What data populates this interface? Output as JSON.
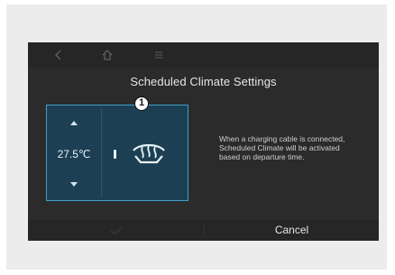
{
  "window": {
    "title": "Scheduled Climate Settings"
  },
  "nav": {
    "icons": [
      "back-arrow-icon",
      "home-icon",
      "menu-icon"
    ]
  },
  "climate": {
    "temperature": "27.5℃",
    "badge_number": "1",
    "mode_icon": "rear-defrost-icon",
    "accent": "#3fa0c9"
  },
  "info": {
    "text": "When a charging cable is connected, Scheduled Climate will be activated based on departure time."
  },
  "actions": {
    "cancel_label": "Cancel"
  }
}
